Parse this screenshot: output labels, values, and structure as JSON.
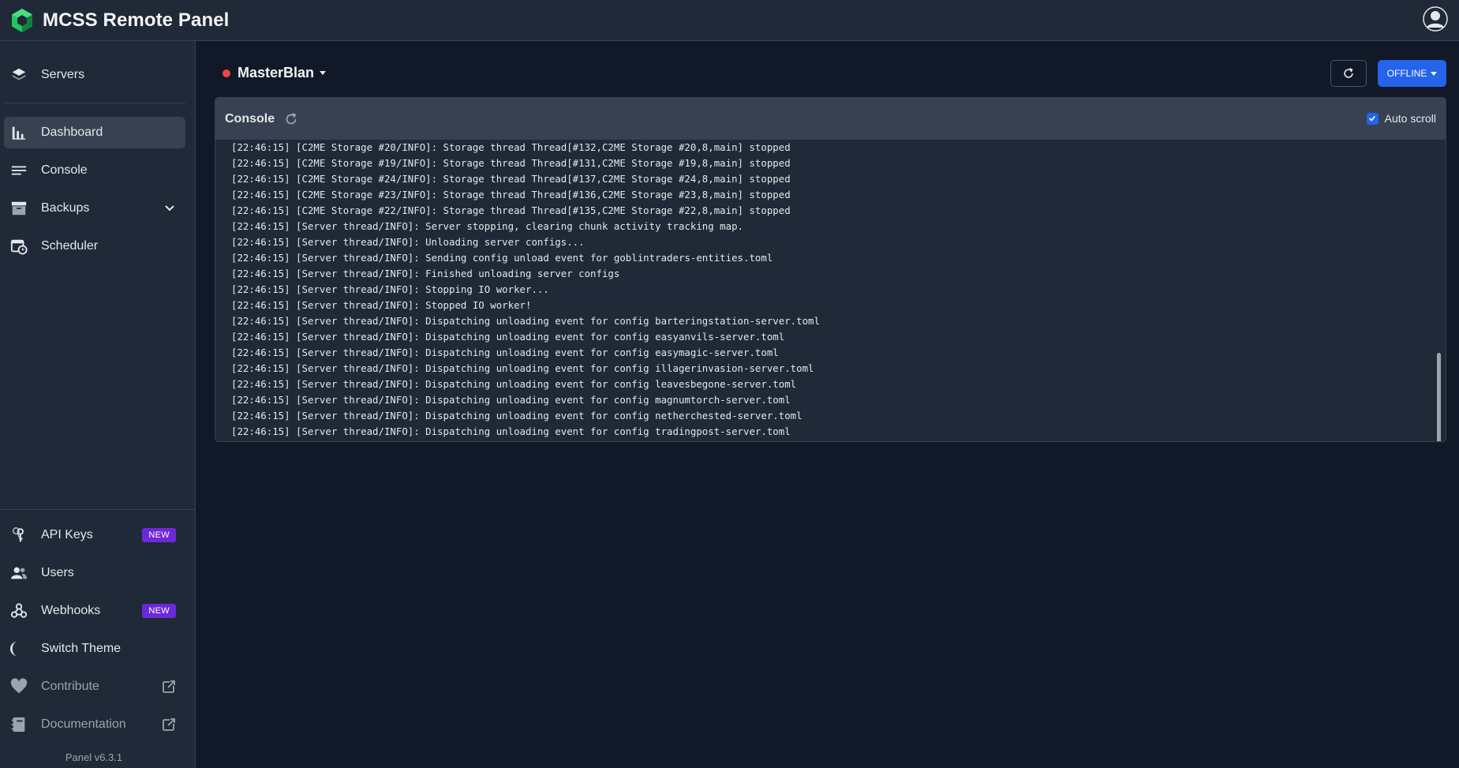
{
  "app": {
    "title": "MCSS Remote Panel"
  },
  "sidebar": {
    "top_items": [
      {
        "label": "Servers",
        "icon": "layers-icon"
      },
      {
        "label": "Dashboard",
        "icon": "bar-chart-icon",
        "active": true
      },
      {
        "label": "Console",
        "icon": "console-lines-icon"
      },
      {
        "label": "Backups",
        "icon": "archive-icon",
        "expandable": true
      },
      {
        "label": "Scheduler",
        "icon": "calendar-clock-icon"
      }
    ],
    "bottom_items": [
      {
        "label": "API Keys",
        "icon": "keys-icon",
        "badge": "NEW"
      },
      {
        "label": "Users",
        "icon": "users-icon"
      },
      {
        "label": "Webhooks",
        "icon": "webhook-icon",
        "badge": "NEW"
      },
      {
        "label": "Switch Theme",
        "icon": "moon-icon"
      },
      {
        "label": "Contribute",
        "icon": "heart-icon",
        "external": true
      },
      {
        "label": "Documentation",
        "icon": "book-icon",
        "external": true
      }
    ],
    "version": "Panel v6.3.1"
  },
  "server": {
    "name": "MasterBlan",
    "status_color": "#ef4444",
    "status_button": "OFFLINE"
  },
  "console": {
    "title": "Console",
    "autoscroll_label": "Auto scroll",
    "autoscroll_checked": true,
    "lines": [
      "[22:46:15] [C2ME Storage #20/INFO]: Storage thread Thread[#132,C2ME Storage #20,8,main] stopped",
      "[22:46:15] [C2ME Storage #19/INFO]: Storage thread Thread[#131,C2ME Storage #19,8,main] stopped",
      "[22:46:15] [C2ME Storage #24/INFO]: Storage thread Thread[#137,C2ME Storage #24,8,main] stopped",
      "[22:46:15] [C2ME Storage #23/INFO]: Storage thread Thread[#136,C2ME Storage #23,8,main] stopped",
      "[22:46:15] [C2ME Storage #22/INFO]: Storage thread Thread[#135,C2ME Storage #22,8,main] stopped",
      "[22:46:15] [Server thread/INFO]: Server stopping, clearing chunk activity tracking map.",
      "[22:46:15] [Server thread/INFO]: Unloading server configs...",
      "[22:46:15] [Server thread/INFO]: Sending config unload event for goblintraders-entities.toml",
      "[22:46:15] [Server thread/INFO]: Finished unloading server configs",
      "[22:46:15] [Server thread/INFO]: Stopping IO worker...",
      "[22:46:15] [Server thread/INFO]: Stopped IO worker!",
      "[22:46:15] [Server thread/INFO]: Dispatching unloading event for config barteringstation-server.toml",
      "[22:46:15] [Server thread/INFO]: Dispatching unloading event for config easyanvils-server.toml",
      "[22:46:15] [Server thread/INFO]: Dispatching unloading event for config easymagic-server.toml",
      "[22:46:15] [Server thread/INFO]: Dispatching unloading event for config illagerinvasion-server.toml",
      "[22:46:15] [Server thread/INFO]: Dispatching unloading event for config leavesbegone-server.toml",
      "[22:46:15] [Server thread/INFO]: Dispatching unloading event for config magnumtorch-server.toml",
      "[22:46:15] [Server thread/INFO]: Dispatching unloading event for config netherchested-server.toml",
      "[22:46:15] [Server thread/INFO]: Dispatching unloading event for config tradingpost-server.toml"
    ]
  },
  "colors": {
    "accent": "#2563eb",
    "badge": "#6d28d9",
    "sidebar_bg": "#1f2937",
    "page_bg": "#111827"
  }
}
